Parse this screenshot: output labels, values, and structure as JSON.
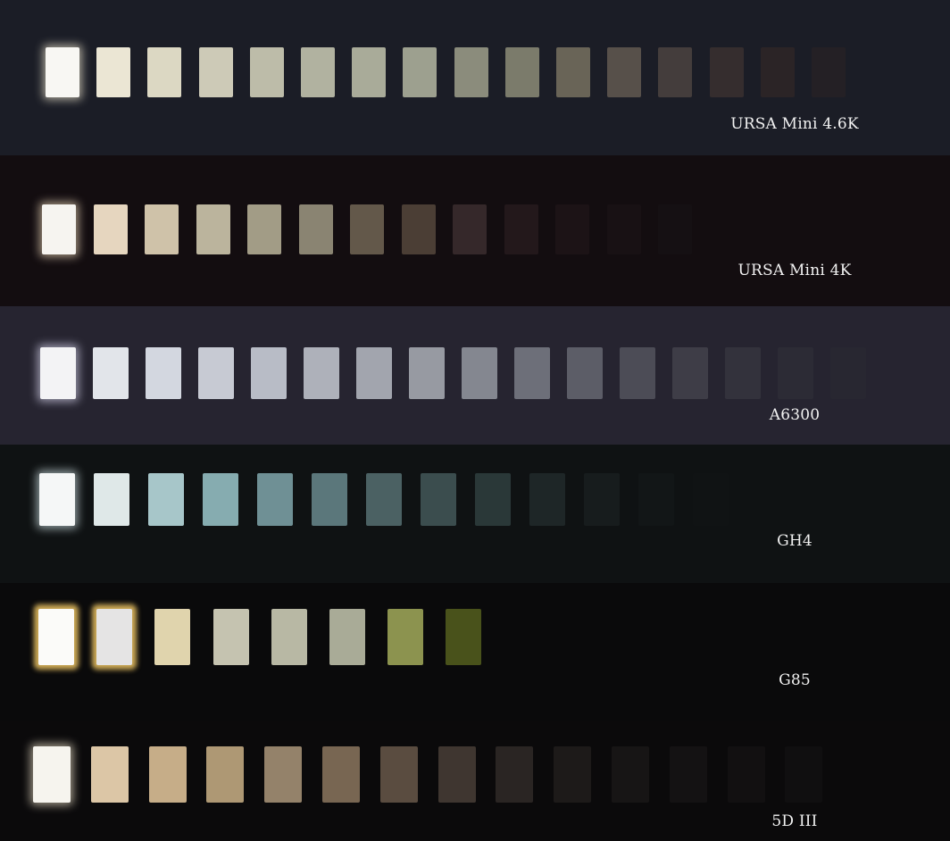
{
  "cameras": [
    {
      "name": "URSA Mini 4.6K",
      "background": "#1b1d26",
      "glow": "#fff6dc",
      "patches": [
        "#f8f7f3",
        "#ebe6d4",
        "#dcd8c3",
        "#cdcab7",
        "#bdbca9",
        "#b1b2a0",
        "#a9ab99",
        "#9da08f",
        "#8b8c7c",
        "#7b7b6b",
        "#696457",
        "#57504a",
        "#443d3c",
        "#352d2e",
        "#2b2426",
        "#242025"
      ]
    },
    {
      "name": "URSA Mini 4K",
      "background": "#130d10",
      "glow": "#ffe9c8",
      "patches": [
        "#f6f4f0",
        "#e6d6bf",
        "#cfc2a9",
        "#bbb49d",
        "#a29c86",
        "#8a8472",
        "#63584a",
        "#4b3e35",
        "#35282a",
        "#23181b",
        "#1c1316",
        "#181114",
        "#151013"
      ]
    },
    {
      "name": "A6300",
      "background": "#262430",
      "glow": "#e8e6ff",
      "patches": [
        "#f3f3f5",
        "#e2e5ea",
        "#d3d7e0",
        "#c7cad3",
        "#b8bcc6",
        "#aeb1ba",
        "#a2a5ae",
        "#979aa2",
        "#848790",
        "#6d6f79",
        "#5c5d67",
        "#4c4c56",
        "#3e3d47",
        "#33323c",
        "#2c2b35",
        "#282731"
      ]
    },
    {
      "name": "GH4",
      "background": "#0f1213",
      "glow": "#e8fbff",
      "patches": [
        "#f5f7f7",
        "#dfe8e8",
        "#a7c6c9",
        "#86acb0",
        "#6f9095",
        "#5b777b",
        "#4b6163",
        "#3b4d4e",
        "#2a3838",
        "#1e2627",
        "#171c1d",
        "#121617",
        "#101314"
      ]
    },
    {
      "name": "G85",
      "background": "#0a0a0b",
      "glow": "#ffd36a",
      "patches": [
        "#fbfbf9",
        "#e5e4e4",
        "#e0d4ad",
        "#c5c3b0",
        "#b8b8a4",
        "#a9ab97",
        "#8c934f",
        "#49521b"
      ]
    },
    {
      "name": "5D III",
      "background": "#0b0a0b",
      "glow": "#fff4d8",
      "patches": [
        "#f6f4ee",
        "#dcc6a6",
        "#c6ad88",
        "#ae9874",
        "#94826a",
        "#786652",
        "#5a4c40",
        "#3f3630",
        "#2a2523",
        "#1d1a19",
        "#171515",
        "#141213",
        "#121011",
        "#100f10"
      ]
    }
  ]
}
